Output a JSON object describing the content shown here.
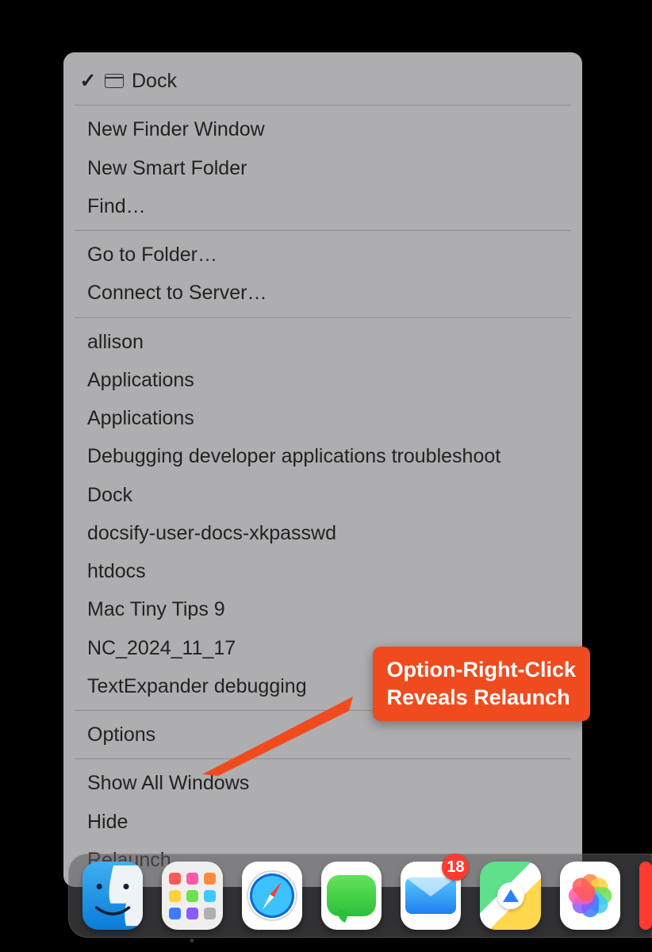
{
  "menu": {
    "header": {
      "checked": true,
      "label": "Dock"
    },
    "section1": [
      "New Finder Window",
      "New Smart Folder",
      "Find…"
    ],
    "section2": [
      "Go to Folder…",
      "Connect to Server…"
    ],
    "section3": [
      "allison",
      "Applications",
      "Applications",
      "Debugging developer applications troubleshoot",
      "Dock",
      "docsify-user-docs-xkpasswd",
      "htdocs",
      "Mac Tiny Tips 9",
      "NC_2024_11_17",
      "TextExpander debugging"
    ],
    "section4": [
      "Options"
    ],
    "section5": [
      "Show All Windows",
      "Hide",
      "Relaunch"
    ]
  },
  "annotation": {
    "text": "Option-Right-Click\nReveals Relaunch",
    "color": "#f04b1f"
  },
  "dock": {
    "apps": [
      {
        "name": "Finder",
        "running": true,
        "badge": null
      },
      {
        "name": "Launchpad",
        "running": true,
        "badge": null
      },
      {
        "name": "Safari",
        "running": false,
        "badge": null
      },
      {
        "name": "Messages",
        "running": false,
        "badge": null
      },
      {
        "name": "Mail",
        "running": false,
        "badge": "18"
      },
      {
        "name": "Maps",
        "running": false,
        "badge": null
      },
      {
        "name": "Photos",
        "running": false,
        "badge": null
      }
    ]
  }
}
